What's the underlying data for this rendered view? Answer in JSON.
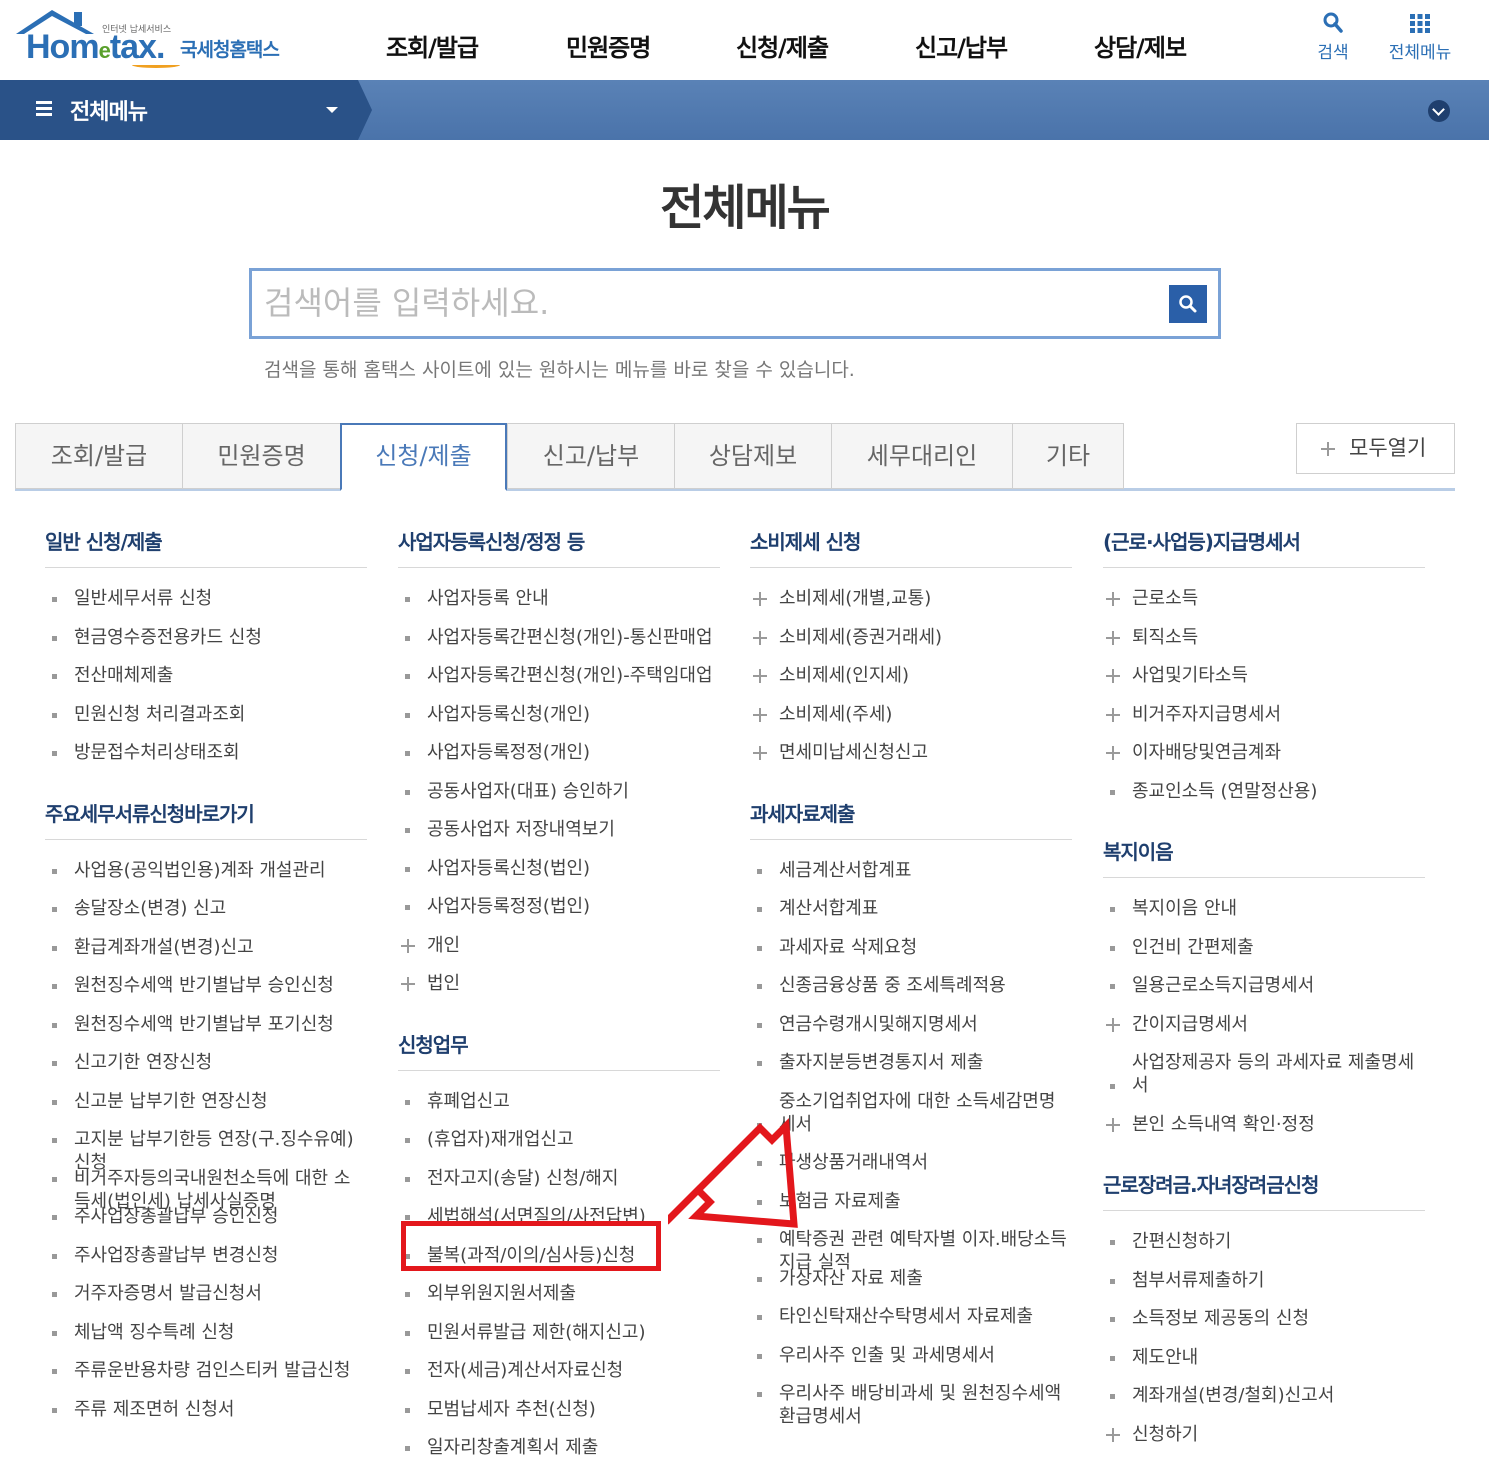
{
  "header": {
    "logo_tiny": "인터넷 납세서비스",
    "logo_word_pre": "Hom",
    "logo_word_e": "e",
    "logo_word_post": "tax.",
    "logo_korean": "국세청홈택스",
    "nav": [
      "조회/발급",
      "민원증명",
      "신청/제출",
      "신고/납부",
      "상담/제보"
    ],
    "search_label": "검색",
    "allmenu_label": "전체메뉴"
  },
  "navbar": {
    "title": "전체메뉴"
  },
  "page": {
    "title": "전체메뉴",
    "search_placeholder": "검색어를 입력하세요.",
    "search_help": "검색을 통해 홈택스 사이트에 있는 원하시는 메뉴를 바로 찾을 수 있습니다."
  },
  "tabs": [
    {
      "label": "조회/발급",
      "active": false
    },
    {
      "label": "민원증명",
      "active": false
    },
    {
      "label": "신청/제출",
      "active": true
    },
    {
      "label": "신고/납부",
      "active": false
    },
    {
      "label": "상담제보",
      "active": false
    },
    {
      "label": "세무대리인",
      "active": false
    },
    {
      "label": "기타",
      "active": false
    }
  ],
  "expand_all": "모두열기",
  "columns": [
    {
      "sections": [
        {
          "title": "일반 신청/제출",
          "items": [
            {
              "label": "일반세무서류 신청",
              "icon": "bullet"
            },
            {
              "label": "현금영수증전용카드 신청",
              "icon": "bullet"
            },
            {
              "label": "전산매체제출",
              "icon": "bullet"
            },
            {
              "label": "민원신청 처리결과조회",
              "icon": "bullet"
            },
            {
              "label": "방문접수처리상태조회",
              "icon": "bullet"
            }
          ]
        },
        {
          "title": "주요세무서류신청바로가기",
          "items": [
            {
              "label": "사업용(공익법인용)계좌 개설관리",
              "icon": "bullet"
            },
            {
              "label": "송달장소(변경) 신고",
              "icon": "bullet"
            },
            {
              "label": "환급계좌개설(변경)신고",
              "icon": "bullet"
            },
            {
              "label": "원천징수세액 반기별납부 승인신청",
              "icon": "bullet"
            },
            {
              "label": "원천징수세액 반기별납부 포기신청",
              "icon": "bullet"
            },
            {
              "label": "신고기한 연장신청",
              "icon": "bullet"
            },
            {
              "label": "신고분 납부기한 연장신청",
              "icon": "bullet"
            },
            {
              "label": "고지분 납부기한등 연장(구.징수유예) 신청",
              "icon": "bullet"
            },
            {
              "label": "비거주자등의국내원천소득에 대한 소득세(법인세) 납세사실증명",
              "icon": "bullet"
            },
            {
              "label": "주사업장총괄납부 승인신청",
              "icon": "bullet"
            },
            {
              "label": "주사업장총괄납부 변경신청",
              "icon": "bullet"
            },
            {
              "label": "거주자증명서 발급신청서",
              "icon": "bullet"
            },
            {
              "label": "체납액 징수특례 신청",
              "icon": "bullet"
            },
            {
              "label": "주류운반용차량 검인스티커 발급신청",
              "icon": "bullet"
            },
            {
              "label": "주류 제조면허 신청서",
              "icon": "bullet"
            }
          ]
        }
      ]
    },
    {
      "sections": [
        {
          "title": "사업자등록신청/정정 등",
          "items": [
            {
              "label": "사업자등록 안내",
              "icon": "bullet"
            },
            {
              "label": "사업자등록간편신청(개인)-통신판매업",
              "icon": "bullet"
            },
            {
              "label": "사업자등록간편신청(개인)-주택임대업",
              "icon": "bullet"
            },
            {
              "label": "사업자등록신청(개인)",
              "icon": "bullet"
            },
            {
              "label": "사업자등록정정(개인)",
              "icon": "bullet"
            },
            {
              "label": "공동사업자(대표) 승인하기",
              "icon": "bullet"
            },
            {
              "label": "공동사업자 저장내역보기",
              "icon": "bullet"
            },
            {
              "label": "사업자등록신청(법인)",
              "icon": "bullet"
            },
            {
              "label": "사업자등록정정(법인)",
              "icon": "bullet"
            },
            {
              "label": "개인",
              "icon": "plus"
            },
            {
              "label": "법인",
              "icon": "plus"
            }
          ]
        },
        {
          "title": "신청업무",
          "items": [
            {
              "label": "휴폐업신고",
              "icon": "bullet"
            },
            {
              "label": "(휴업자)재개업신고",
              "icon": "bullet"
            },
            {
              "label": "전자고지(송달) 신청/해지",
              "icon": "bullet"
            },
            {
              "label": "세법해석(서면질의/사전답변)",
              "icon": "bullet"
            },
            {
              "label": "불복(과적/이의/심사등)신청",
              "icon": "bullet"
            },
            {
              "label": "외부위원지원서제출",
              "icon": "bullet"
            },
            {
              "label": "민원서류발급 제한(해지신고)",
              "icon": "bullet"
            },
            {
              "label": "전자(세금)계산서자료신청",
              "icon": "bullet"
            },
            {
              "label": "모범납세자 추천(신청)",
              "icon": "bullet"
            },
            {
              "label": "일자리창출계획서 제출",
              "icon": "bullet"
            }
          ]
        }
      ]
    },
    {
      "sections": [
        {
          "title": "소비제세 신청",
          "items": [
            {
              "label": "소비제세(개별,교통)",
              "icon": "plus"
            },
            {
              "label": "소비제세(증권거래세)",
              "icon": "plus"
            },
            {
              "label": "소비제세(인지세)",
              "icon": "plus"
            },
            {
              "label": "소비제세(주세)",
              "icon": "plus"
            },
            {
              "label": "면세미납세신청신고",
              "icon": "plus"
            }
          ]
        },
        {
          "title": "과세자료제출",
          "items": [
            {
              "label": "세금계산서합계표",
              "icon": "bullet"
            },
            {
              "label": "계산서합계표",
              "icon": "bullet"
            },
            {
              "label": "과세자료 삭제요청",
              "icon": "bullet"
            },
            {
              "label": "신종금융상품 중 조세특례적용",
              "icon": "bullet"
            },
            {
              "label": "연금수령개시및해지명세서",
              "icon": "bullet"
            },
            {
              "label": "출자지분등변경통지서 제출",
              "icon": "bullet"
            },
            {
              "label": "중소기업취업자에 대한 소득세감면명세서",
              "icon": "bullet"
            },
            {
              "label": "파생상품거래내역서",
              "icon": "bullet"
            },
            {
              "label": "보험금 자료제출",
              "icon": "bullet"
            },
            {
              "label": "예탁증권 관련 예탁자별 이자.배당소득 지급 실적",
              "icon": "bullet"
            },
            {
              "label": "가상자산 자료 제출",
              "icon": "bullet"
            },
            {
              "label": "타인신탁재산수탁명세서 자료제출",
              "icon": "bullet"
            },
            {
              "label": "우리사주 인출 및 과세명세서",
              "icon": "bullet"
            },
            {
              "label": "우리사주 배당비과세 및 원천징수세액 환급명세서",
              "icon": "bullet"
            }
          ]
        }
      ]
    },
    {
      "sections": [
        {
          "title": "(근로·사업등)지급명세서",
          "items": [
            {
              "label": "근로소득",
              "icon": "plus"
            },
            {
              "label": "퇴직소득",
              "icon": "plus"
            },
            {
              "label": "사업및기타소득",
              "icon": "plus"
            },
            {
              "label": "비거주자지급명세서",
              "icon": "plus"
            },
            {
              "label": "이자배당및연금계좌",
              "icon": "plus"
            },
            {
              "label": "종교인소득 (연말정산용)",
              "icon": "bullet"
            }
          ]
        },
        {
          "title": "복지이음",
          "items": [
            {
              "label": "복지이음 안내",
              "icon": "bullet"
            },
            {
              "label": "인건비 간편제출",
              "icon": "bullet"
            },
            {
              "label": "일용근로소득지급명세서",
              "icon": "bullet"
            },
            {
              "label": "간이지급명세서",
              "icon": "plus"
            },
            {
              "label": "사업장제공자 등의 과세자료 제출명세서",
              "icon": "bullet"
            },
            {
              "label": "본인 소득내역 확인·정정",
              "icon": "plus"
            }
          ]
        },
        {
          "title": "근로장려금.자녀장려금신청",
          "items": [
            {
              "label": "간편신청하기",
              "icon": "bullet"
            },
            {
              "label": "첨부서류제출하기",
              "icon": "bullet"
            },
            {
              "label": "소득정보 제공동의 신청",
              "icon": "bullet"
            },
            {
              "label": "제도안내",
              "icon": "bullet"
            },
            {
              "label": "계좌개설(변경/철회)신고서",
              "icon": "bullet"
            },
            {
              "label": "신청하기",
              "icon": "plus"
            }
          ]
        }
      ]
    }
  ],
  "colors": {
    "brand_blue": "#2b6fb5",
    "nav_dark": "#2a5288",
    "nav_light": "#5a82b6",
    "section_title": "#1f3f6e",
    "annotation_red": "#e3171c"
  }
}
